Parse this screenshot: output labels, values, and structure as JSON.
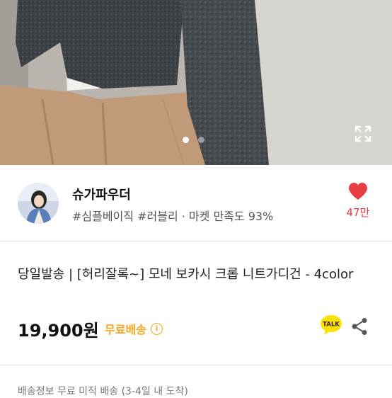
{
  "hero": {
    "active_index": 1,
    "total": 2,
    "expand_icon": "expand-arrows-icon"
  },
  "seller": {
    "name": "슈가파우더",
    "meta": "#심플베이직 #러블리 · 마켓 만족도 93%",
    "like_count": "47만",
    "like_icon": "heart-icon",
    "colors": {
      "like": "#e83e44"
    }
  },
  "product": {
    "title": "당일발송 | [허리잘록~] 모네 보카시 크롭 니트가디건 - 4color",
    "price": "19,900원",
    "shipping": "무료배송",
    "talk_label": "TALK",
    "share_icon": "share-icon",
    "colors": {
      "shipping": "#f5a623",
      "talk": "#3c1e1e",
      "talk_bg": "#fae100"
    }
  },
  "next_row": {
    "text": "배송정보    무료 미직 배송 (3-4일 내 도착)"
  }
}
